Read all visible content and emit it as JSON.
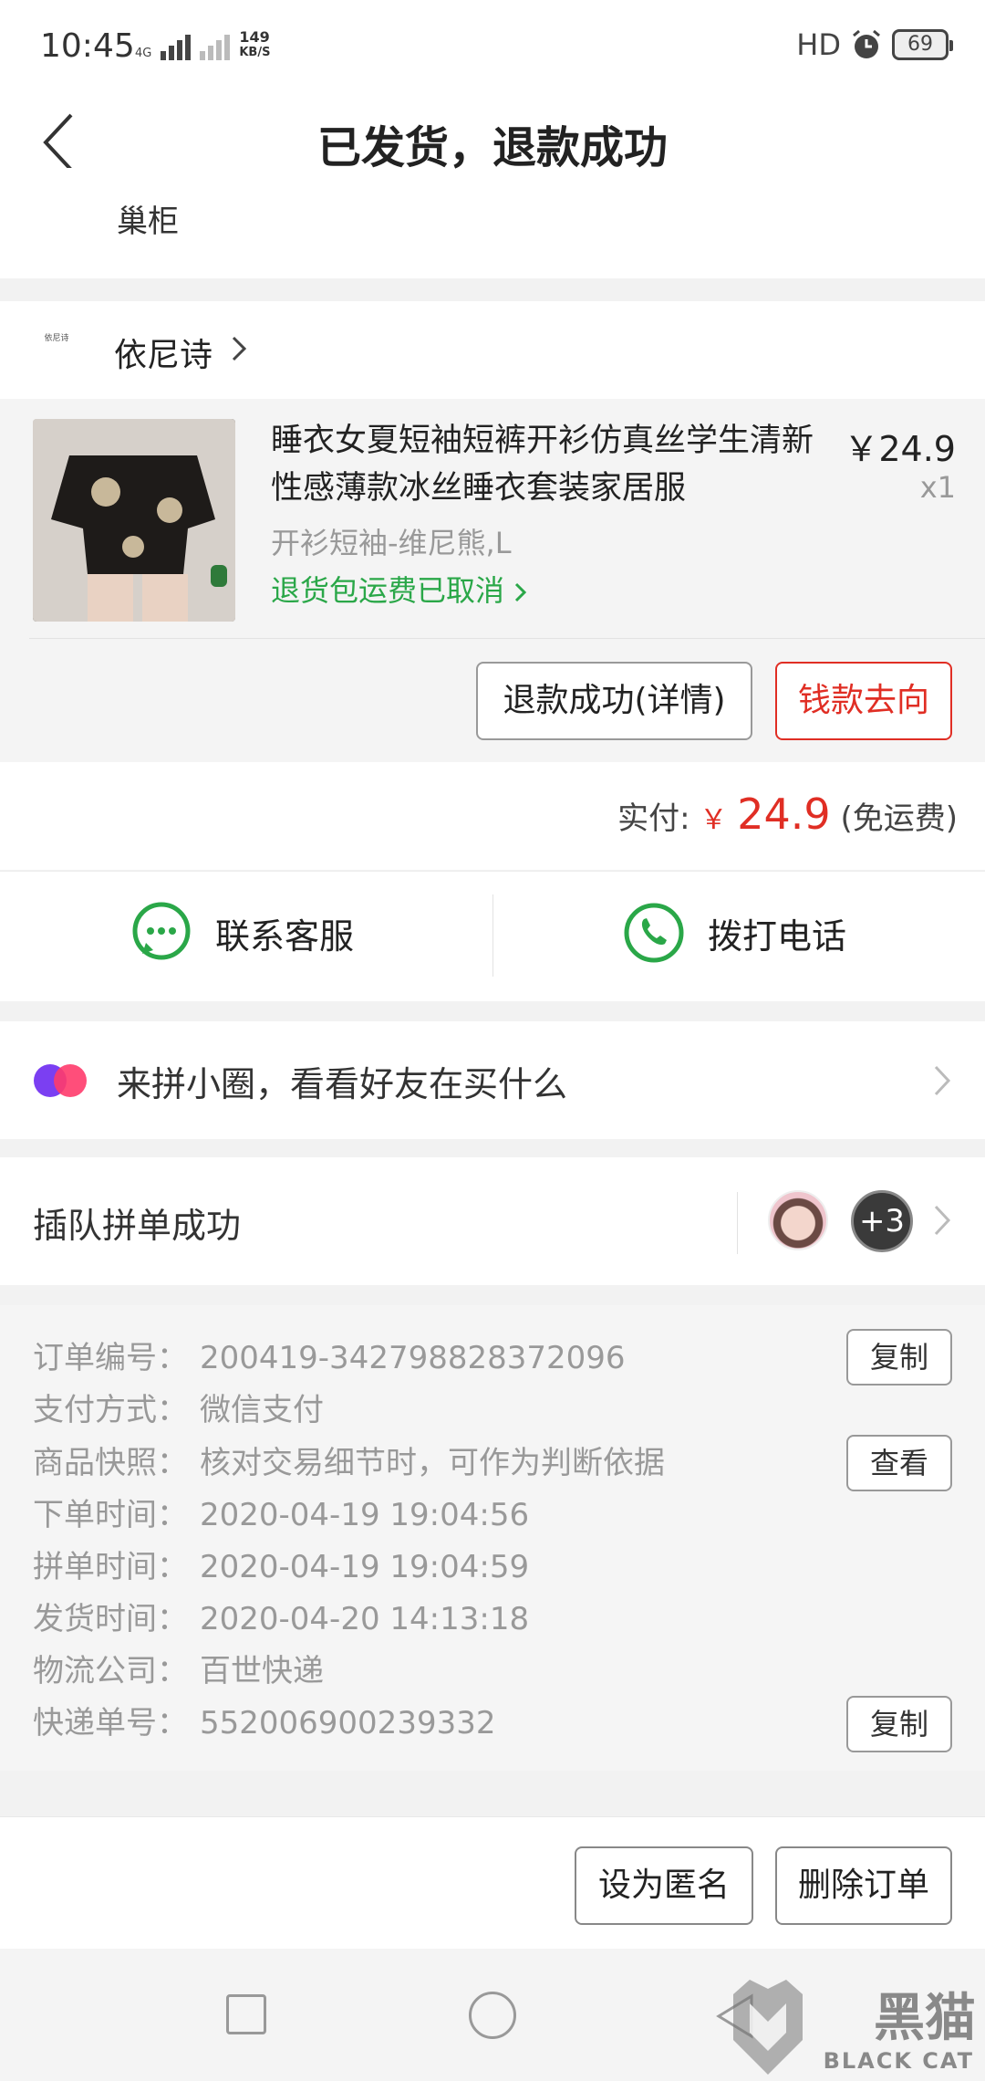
{
  "status_bar": {
    "time": "10:45",
    "network_tag": "4G",
    "speed_value": "149",
    "speed_unit": "KB/S",
    "hd_label": "HD",
    "battery": "69"
  },
  "header": {
    "title": "已发货，退款成功",
    "subtitle": "巢柜"
  },
  "shop": {
    "logo_text": "依尼诗",
    "name": "依尼诗"
  },
  "product": {
    "title": "睡衣女夏短袖短裤开衫仿真丝学生清新性感薄款冰丝睡衣套装家居服",
    "price": "￥24.9",
    "quantity": "x1",
    "spec": "开衫短袖-维尼熊,L",
    "return_shipping": "退货包运费已取消",
    "refund_button": "退款成功(详情)",
    "money_button": "钱款去向"
  },
  "payment": {
    "label": "实付:",
    "currency": "￥",
    "amount": "24.9",
    "note": "(免运费)"
  },
  "contact": {
    "service_label": "联系客服",
    "phone_label": "拨打电话"
  },
  "circle": {
    "text": "来拼小圈，看看好友在买什么"
  },
  "group": {
    "text": "插队拼单成功",
    "extra_count": "+3"
  },
  "order_info": {
    "rows": [
      {
        "label": "订单编号：",
        "value": "200419-342798828372096",
        "button": "复制"
      },
      {
        "label": "支付方式：",
        "value": "微信支付"
      },
      {
        "label": "商品快照：",
        "value": "核对交易细节时，可作为判断依据",
        "button": "查看"
      },
      {
        "label": "下单时间：",
        "value": "2020-04-19 19:04:56"
      },
      {
        "label": "拼单时间：",
        "value": "2020-04-19 19:04:59"
      },
      {
        "label": "发货时间：",
        "value": "2020-04-20 14:13:18"
      },
      {
        "label": "物流公司：",
        "value": "百世快递"
      },
      {
        "label": "快递单号：",
        "value": "552006900239332",
        "button": "复制"
      }
    ]
  },
  "bottom": {
    "anonymous_button": "设为匿名",
    "delete_button": "删除订单"
  },
  "watermark": {
    "text": "黑猫",
    "sub": "BLACK CAT"
  },
  "colors": {
    "accent_red": "#e02e24",
    "green": "#2aa748",
    "circle_purple": "#7b3ff2",
    "circle_pink": "#ff3b6b"
  }
}
